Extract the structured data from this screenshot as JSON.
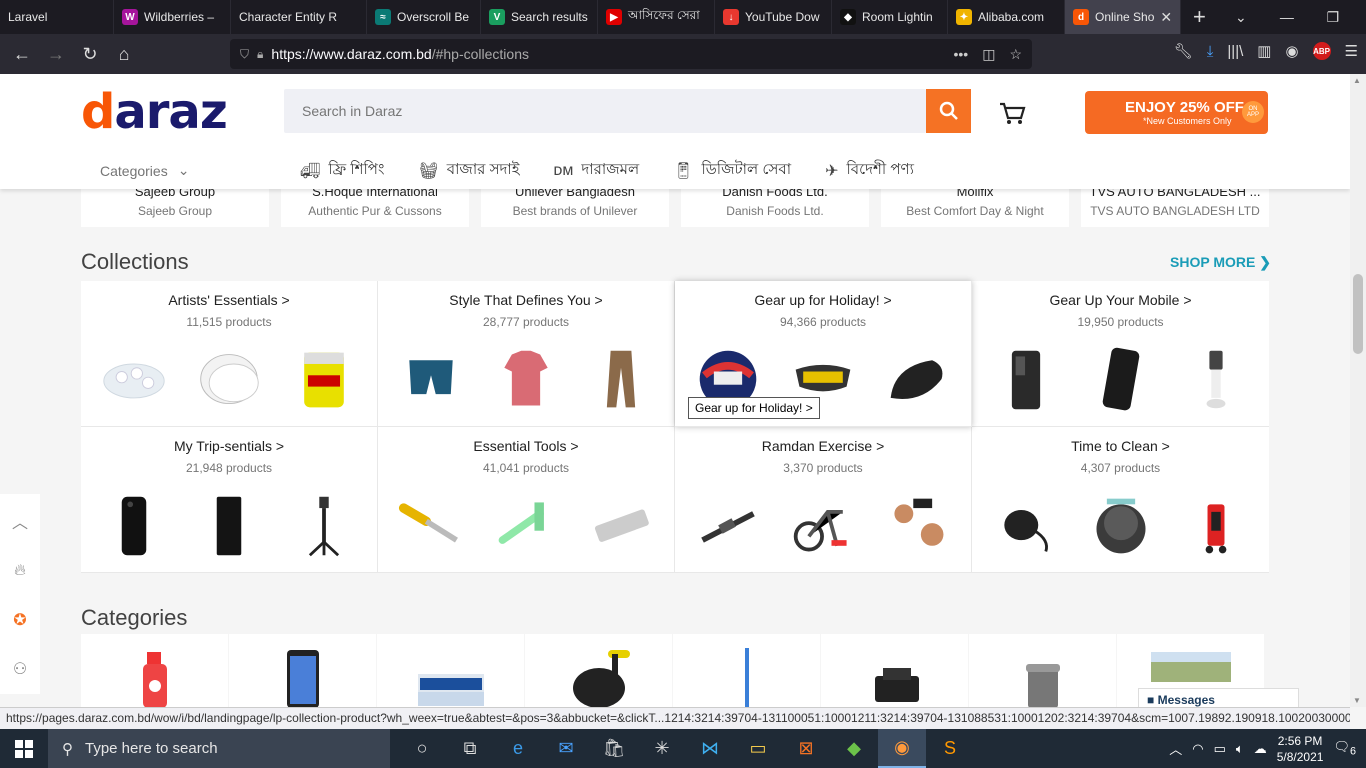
{
  "browser": {
    "tabs": [
      {
        "title": "Laravel",
        "color": "#1c1b22",
        "glyph": ""
      },
      {
        "title": "Wildberries –",
        "color": "#a6159c",
        "glyph": "W"
      },
      {
        "title": "Character Entity R",
        "color": "#1c1b22",
        "glyph": ""
      },
      {
        "title": "Overscroll Be",
        "color": "#0b7a75",
        "glyph": "≈"
      },
      {
        "title": "Search results",
        "color": "#1a9e5f",
        "glyph": "V"
      },
      {
        "title": "আসিফের সেরা",
        "color": "#e00000",
        "glyph": "▶"
      },
      {
        "title": "YouTube Dow",
        "color": "#e8382f",
        "glyph": "↓"
      },
      {
        "title": "Room Lightin",
        "color": "#111",
        "glyph": "◆"
      },
      {
        "title": "Alibaba.com",
        "color": "#f0b400",
        "glyph": "✦"
      },
      {
        "title": "Online Sho",
        "color": "#f85606",
        "glyph": "d",
        "active": true
      }
    ],
    "url_host": "https://www.daraz.com.bd",
    "url_path": "/#hp-collections"
  },
  "header": {
    "logo": "daraz",
    "search_placeholder": "Search in Daraz",
    "promo_big": "ENJOY 25% OFF",
    "promo_small": "*New Customers Only",
    "promo_badge": "ON APP",
    "categories_label": "Categories",
    "nav": [
      "ফ্রি শিপিং",
      "বাজার সদাই",
      "দারাজমল",
      "ডিজিটাল সেবা",
      "বিদেশী পণ্য"
    ]
  },
  "brands": [
    {
      "name": "Sajeeb Group",
      "sub": "Sajeeb Group"
    },
    {
      "name": "S.Hoque International",
      "sub": "Authentic Pur & Cussons"
    },
    {
      "name": "Unilever Bangladesh",
      "sub": "Best brands of Unilever"
    },
    {
      "name": "Danish Foods Ltd.",
      "sub": "Danish Foods Ltd."
    },
    {
      "name": "Mollfix",
      "sub": "Best Comfort Day & Night"
    },
    {
      "name": "TVS AUTO BANGLADESH ...",
      "sub": "TVS AUTO BANGLADESH LTD"
    }
  ],
  "collections": {
    "title": "Collections",
    "shop_more": "SHOP MORE",
    "items": [
      {
        "title": "Artists' Essentials >",
        "count": "11,515 products"
      },
      {
        "title": "Style That Defines You >",
        "count": "28,777 products"
      },
      {
        "title": "Gear up for Holiday! >",
        "count": "94,366 products"
      },
      {
        "title": "Gear Up Your Mobile >",
        "count": "19,950 products"
      },
      {
        "title": "My Trip-sentials >",
        "count": "21,948 products"
      },
      {
        "title": "Essential Tools >",
        "count": "41,041 products"
      },
      {
        "title": "Ramdan Exercise >",
        "count": "3,370 products"
      },
      {
        "title": "Time to Clean >",
        "count": "4,307 products"
      }
    ],
    "tooltip": "Gear up for Holiday! >"
  },
  "categories_title": "Categories",
  "messages_label": "Messages",
  "status_url": "https://pages.daraz.com.bd/wow/i/bd/landingpage/lp-collection-product?wh_weex=true&abtest=&pos=3&abbucket=&clickT...1214:3214:39704-131100051:10001211:3214:39704-131088531:10001202:3214:39704&scm=1007.19892.190918.100200300000000",
  "taskbar": {
    "search_placeholder": "Type here to search",
    "time": "2:56 PM",
    "date": "5/8/2021",
    "notif_count": "6"
  }
}
